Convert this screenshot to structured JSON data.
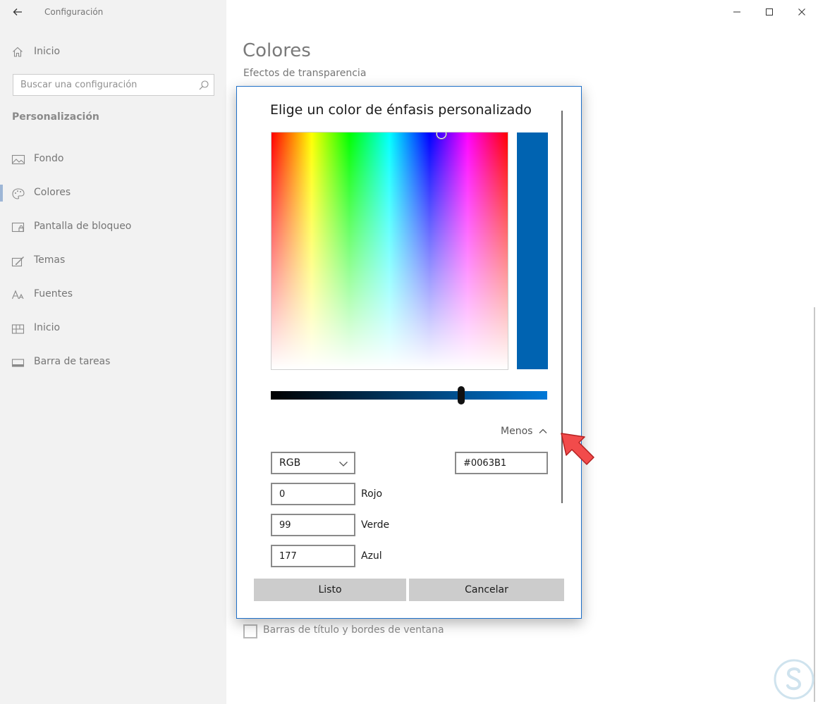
{
  "window": {
    "app_title": "Configuración",
    "controls": {
      "minimize_icon": "minimize-icon",
      "maximize_icon": "maximize-icon",
      "close_icon": "close-icon"
    }
  },
  "sidebar": {
    "home": {
      "label": "Inicio",
      "icon": "home-icon"
    },
    "search": {
      "placeholder": "Buscar una configuración",
      "value": ""
    },
    "section_title": "Personalización",
    "items": [
      {
        "label": "Fondo",
        "icon": "image-icon",
        "selected": false
      },
      {
        "label": "Colores",
        "icon": "palette-icon",
        "selected": true
      },
      {
        "label": "Pantalla de bloqueo",
        "icon": "lock-screen-icon",
        "selected": false
      },
      {
        "label": "Temas",
        "icon": "themes-brush-icon",
        "selected": false
      },
      {
        "label": "Fuentes",
        "icon": "font-icon",
        "selected": false
      },
      {
        "label": "Inicio",
        "icon": "start-grid-icon",
        "selected": false
      },
      {
        "label": "Barra de tareas",
        "icon": "taskbar-icon",
        "selected": false
      }
    ]
  },
  "main": {
    "page_title": "Colores",
    "subtitle": "Efectos de transparencia",
    "checkbox_title_bars": {
      "label": "Barras de título y bordes de ventana",
      "checked": false
    }
  },
  "dialog": {
    "title": "Elige un color de énfasis personalizado",
    "selected_color": "#0063B1",
    "value_slider_fraction": 0.69,
    "less_label": "Menos",
    "mode": {
      "selected": "RGB"
    },
    "hex_value": "#0063B1",
    "channels": [
      {
        "label": "Rojo",
        "value": "0"
      },
      {
        "label": "Verde",
        "value": "99"
      },
      {
        "label": "Azul",
        "value": "177"
      }
    ],
    "buttons": {
      "ok": "Listo",
      "cancel": "Cancelar"
    }
  },
  "colors": {
    "accent": "#0063B1",
    "sidebar_bg": "#f2f2f2",
    "dialog_border": "#1e6fc8",
    "arrow": "#f24b4b"
  }
}
